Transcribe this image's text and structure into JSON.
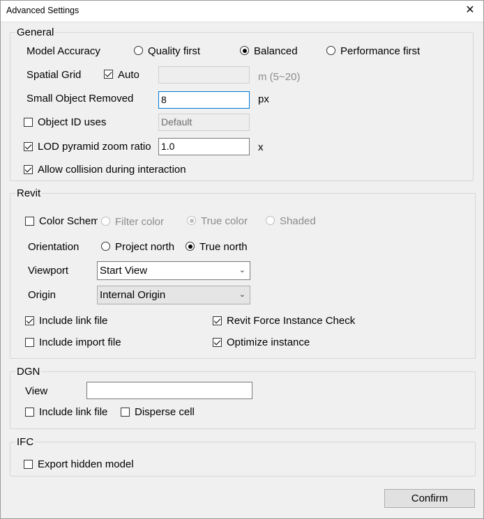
{
  "window": {
    "title": "Advanced Settings",
    "close_glyph": "✕"
  },
  "general": {
    "legend": "General",
    "model_accuracy_label": "Model Accuracy",
    "accuracy_options": [
      "Quality first",
      "Balanced",
      "Performance first"
    ],
    "accuracy_selected": "Balanced",
    "spatial_grid_label": "Spatial Grid",
    "auto_label": "Auto",
    "auto_checked": true,
    "spatial_grid_value": "",
    "spatial_grid_unit": "m (5~20)",
    "small_object_label": "Small Object Removed",
    "small_object_value": "8",
    "small_object_unit": "px",
    "object_id_label": "Object ID uses",
    "object_id_checked": false,
    "object_id_value": "Default",
    "lod_label": "LOD pyramid zoom ratio",
    "lod_checked": true,
    "lod_value": "1.0",
    "lod_unit": "x",
    "allow_collision_label": "Allow collision during interaction",
    "allow_collision_checked": true
  },
  "revit": {
    "legend": "Revit",
    "color_scheme_label": "Color Schem",
    "color_scheme_checked": false,
    "color_options": [
      "Filter color",
      "True color",
      "Shaded"
    ],
    "color_selected": "True color",
    "orientation_label": "Orientation",
    "orientation_options": [
      "Project north",
      "True north"
    ],
    "orientation_selected": "True north",
    "viewport_label": "Viewport",
    "viewport_value": "Start View",
    "origin_label": "Origin",
    "origin_value": "Internal Origin",
    "include_link_label": "Include link file",
    "include_link_checked": true,
    "force_instance_label": "Revit Force Instance Check",
    "force_instance_checked": true,
    "include_import_label": "Include import file",
    "include_import_checked": false,
    "optimize_instance_label": "Optimize instance",
    "optimize_instance_checked": true
  },
  "dgn": {
    "legend": "DGN",
    "view_label": "View",
    "view_value": "",
    "include_link_label": "Include link file",
    "include_link_checked": false,
    "disperse_cell_label": "Disperse cell",
    "disperse_cell_checked": false
  },
  "ifc": {
    "legend": "IFC",
    "export_hidden_label": "Export hidden model",
    "export_hidden_checked": false
  },
  "footer": {
    "confirm_label": "Confirm"
  }
}
